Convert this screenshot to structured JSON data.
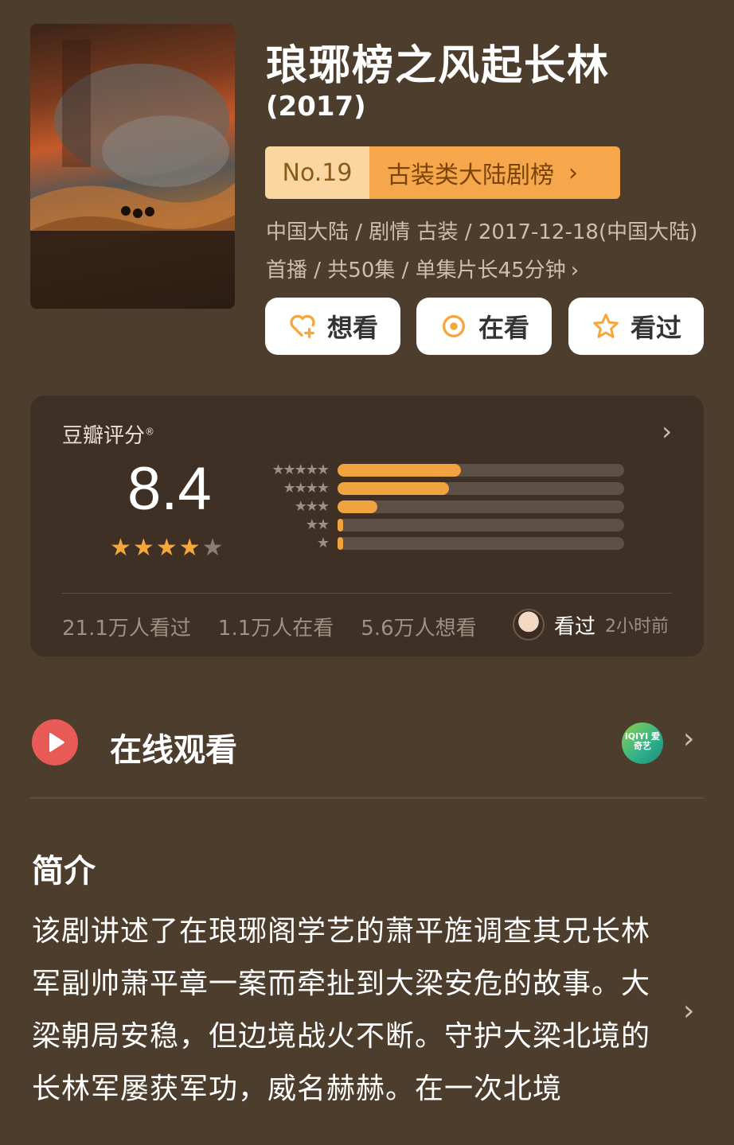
{
  "header": {
    "title": "琅琊榜之风起长林",
    "year": "(2017)",
    "rank": {
      "number": "No.19",
      "list_name": "古装类大陆剧榜",
      "chevron": "›"
    },
    "meta_line": "中国大陆 / 剧情 古装 / 2017-12-18(中国大陆)首播 / 共50集 / 单集片长45分钟",
    "meta_chevron": "›"
  },
  "actions": {
    "want": "想看",
    "watching": "在看",
    "watched": "看过"
  },
  "rating": {
    "label": "豆瓣评分",
    "registered_mark": "®",
    "chevron": "›",
    "score": "8.4",
    "star_count": 4,
    "star_total": 5,
    "distribution": [
      {
        "stars": "★★★★★",
        "fraction": 0.43
      },
      {
        "stars": "★★★★",
        "fraction": 0.39
      },
      {
        "stars": "★★★",
        "fraction": 0.14
      },
      {
        "stars": "★★",
        "fraction": 0.02
      },
      {
        "stars": "★",
        "fraction": 0.01
      }
    ],
    "stats": {
      "watched": "21.1万人看过",
      "watching": "1.1万人在看",
      "want": "5.6万人想看"
    },
    "my_status": "看过",
    "my_time": "2小时前"
  },
  "watch": {
    "title": "在线观看",
    "provider_badge": "iQIYI 爱奇艺",
    "chevron": "›"
  },
  "synopsis": {
    "title": "简介",
    "text": "该剧讲述了在琅琊阁学艺的萧平旌调查其兄长林军副帅萧平章一案而牵扯到大梁安危的故事。大梁朝局安稳，但边境战火不断。守护大梁北境的长林军屡获军功，威名赫赫。在一次北境",
    "chevron": "›"
  },
  "colors": {
    "background": "#4d3d2d",
    "card": "#3e3024",
    "accent": "#f6a74b",
    "star": "#f6a73b",
    "play_red": "#e85a55"
  }
}
